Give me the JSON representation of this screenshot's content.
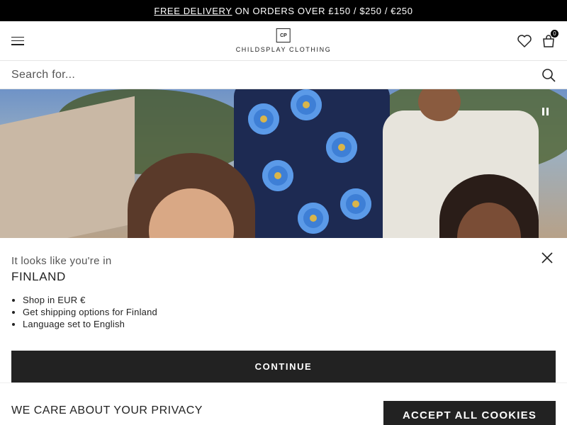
{
  "promo": {
    "link_text": "FREE DELIVERY",
    "rest_text": "ON ORDERS OVER £150 / $250 / €250"
  },
  "header": {
    "logo_mark": "CP",
    "logo_text": "CHILDSPLAY CLOTHING",
    "bag_count": "0",
    "icons": [
      "menu-icon",
      "heart-icon",
      "bag-icon"
    ]
  },
  "search": {
    "placeholder": "Search for..."
  },
  "hero": {
    "control": "pause-icon"
  },
  "geo": {
    "intro": "It looks like you're in",
    "country": "FINLAND",
    "items": [
      "Shop in EUR €",
      "Get shipping options for Finland",
      "Language set to English"
    ],
    "continue_label": "CONTINUE"
  },
  "cookie": {
    "title": "WE CARE ABOUT YOUR PRIVACY",
    "accept_label": "ACCEPT ALL COOKIES"
  },
  "colors": {
    "promo_bg": "#000000",
    "button_bg": "#222222",
    "text": "#222222"
  }
}
